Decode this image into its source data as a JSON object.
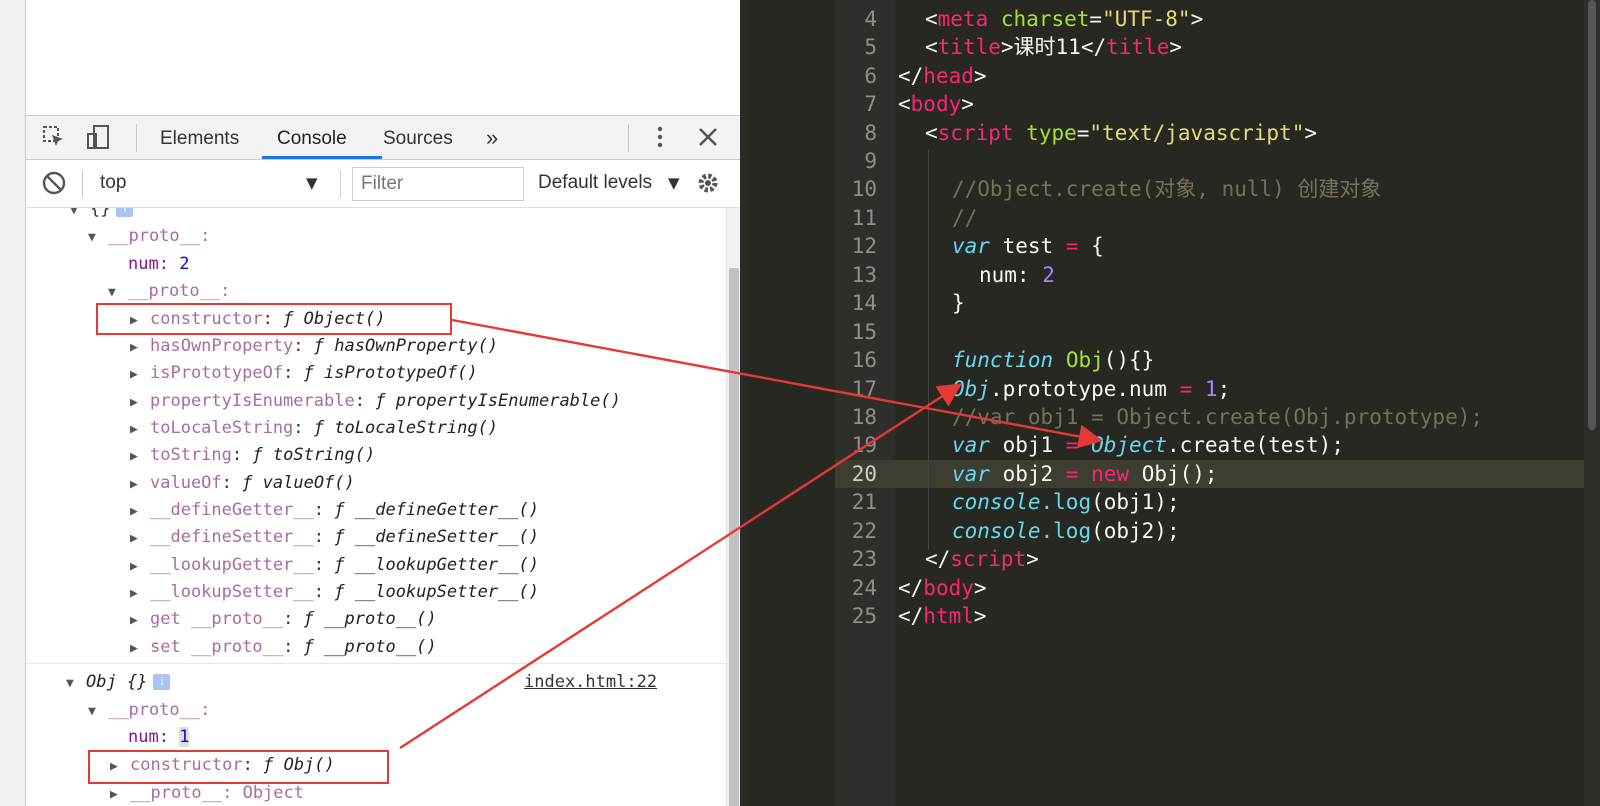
{
  "devtools": {
    "tabs": [
      "Elements",
      "Console",
      "Sources"
    ],
    "more_tabs": "»",
    "active_tab": "Console",
    "context": "top",
    "filter_placeholder": "Filter",
    "levels": "Default levels"
  },
  "console": {
    "obj1": {
      "header": "{}",
      "proto_label": "__proto__:",
      "num_key": "num:",
      "num_val": "2",
      "inner_proto_label": "__proto__:",
      "members": [
        {
          "key": "constructor",
          "val": "Object()"
        },
        {
          "key": "hasOwnProperty",
          "val": "hasOwnProperty()"
        },
        {
          "key": "isPrototypeOf",
          "val": "isPrototypeOf()"
        },
        {
          "key": "propertyIsEnumerable",
          "val": "propertyIsEnumerable()"
        },
        {
          "key": "toLocaleString",
          "val": "toLocaleString()"
        },
        {
          "key": "toString",
          "val": "toString()"
        },
        {
          "key": "valueOf",
          "val": "valueOf()"
        },
        {
          "key": "__defineGetter__",
          "val": "__defineGetter__()"
        },
        {
          "key": "__defineSetter__",
          "val": "__defineSetter__()"
        },
        {
          "key": "__lookupGetter__",
          "val": "__lookupGetter__()"
        },
        {
          "key": "__lookupSetter__",
          "val": "__lookupSetter__()"
        },
        {
          "key": "get __proto__",
          "val": "__proto__()"
        },
        {
          "key": "set __proto__",
          "val": "__proto__()"
        }
      ]
    },
    "obj2": {
      "header": "Obj {}",
      "source": "index.html:22",
      "proto_label": "__proto__:",
      "num_key": "num:",
      "num_val": "1",
      "constructor_key": "constructor",
      "constructor_val": "Obj()",
      "partial": "__proto__: Object"
    },
    "fn_symbol": "ƒ",
    "info_badge": "i"
  },
  "editor": {
    "lines": [
      {
        "n": "4"
      },
      {
        "n": "5"
      },
      {
        "n": "6"
      },
      {
        "n": "7"
      },
      {
        "n": "8"
      },
      {
        "n": "9"
      },
      {
        "n": "10"
      },
      {
        "n": "11"
      },
      {
        "n": "12"
      },
      {
        "n": "13"
      },
      {
        "n": "14"
      },
      {
        "n": "15"
      },
      {
        "n": "16"
      },
      {
        "n": "17"
      },
      {
        "n": "18"
      },
      {
        "n": "19"
      },
      {
        "n": "20"
      },
      {
        "n": "21"
      },
      {
        "n": "22"
      },
      {
        "n": "23"
      },
      {
        "n": "24"
      },
      {
        "n": "25"
      }
    ],
    "t": {
      "lt": "<",
      "gt": ">",
      "lts": "</",
      "meta": "meta",
      "charset": "charset",
      "eq": "=",
      "utf8": "\"UTF-8\"",
      "title": "title",
      "title_text": "课时11",
      "head": "head",
      "body": "body",
      "script": "script",
      "type": "type",
      "type_val": "\"text/javascript\"",
      "c10": "//Object.create(对象, null) 创建对象",
      "c11": "//",
      "var": "var",
      "test": " test ",
      "brace_open": " {",
      "num_key": "num: ",
      "num_val": "2",
      "brace_close": "}",
      "function": "function",
      "obj_name": "Obj",
      "fn_tail": "(){}",
      "obj_ref": "Obj",
      "proto_num": ".prototype.num ",
      "one": "1",
      "semi": ";",
      "c18": "//var obj1 = Object.create(Obj.prototype);",
      "obj1": " obj1 ",
      "object": "Object",
      "create": ".create(test);",
      "obj2": " obj2 ",
      "new": "new",
      "obj_call": " Obj(",
      "call_end": ");",
      "console": "console",
      "log": ".log",
      "log1": "(obj1);",
      "log2": "(obj2);",
      "html": "html"
    }
  }
}
